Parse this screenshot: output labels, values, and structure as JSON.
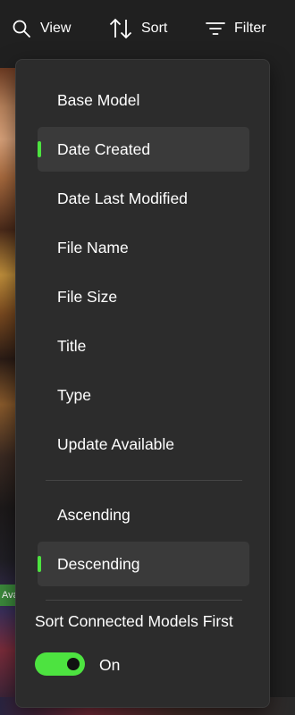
{
  "toolbar": {
    "view_label": "View",
    "sort_label": "Sort",
    "filter_label": "Filter"
  },
  "background": {
    "badge_text": "Avai"
  },
  "sort_menu": {
    "fields": [
      {
        "label": "Base Model",
        "selected": false
      },
      {
        "label": "Date Created",
        "selected": true
      },
      {
        "label": "Date Last Modified",
        "selected": false
      },
      {
        "label": "File Name",
        "selected": false
      },
      {
        "label": "File Size",
        "selected": false
      },
      {
        "label": "Title",
        "selected": false
      },
      {
        "label": "Type",
        "selected": false
      },
      {
        "label": "Update Available",
        "selected": false
      }
    ],
    "directions": [
      {
        "label": "Ascending",
        "selected": false
      },
      {
        "label": "Descending",
        "selected": true
      }
    ],
    "toggle": {
      "label": "Sort Connected Models First",
      "state_label": "On",
      "on": true
    }
  },
  "colors": {
    "accent": "#4de340",
    "menu_bg": "#2c2c2c",
    "selected_bg": "#3a3a3a",
    "app_bg": "#202020"
  }
}
